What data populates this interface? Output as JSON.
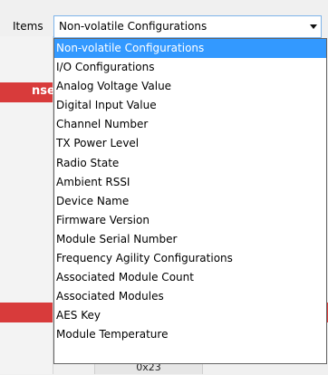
{
  "background": {
    "partial_header_text": "nse",
    "bottom_cell_text": "0x23"
  },
  "items": {
    "label": "Items",
    "selected": "Non-volatile Configurations",
    "options": [
      "Non-volatile Configurations",
      "I/O Configurations",
      "Analog Voltage Value",
      "Digital Input Value",
      "Channel Number",
      "TX Power Level",
      "Radio State",
      "Ambient RSSI",
      "Device Name",
      "Firmware Version",
      "Module Serial Number",
      "Frequency Agility Configurations",
      "Associated Module Count",
      "Associated Modules",
      "AES Key",
      "Module Temperature"
    ]
  },
  "colors": {
    "selection": "#3399ff",
    "header_red": "#d83b3b",
    "combo_border": "#7eb4ea"
  },
  "icons": {
    "combo_arrow": "chevron-down-icon"
  }
}
